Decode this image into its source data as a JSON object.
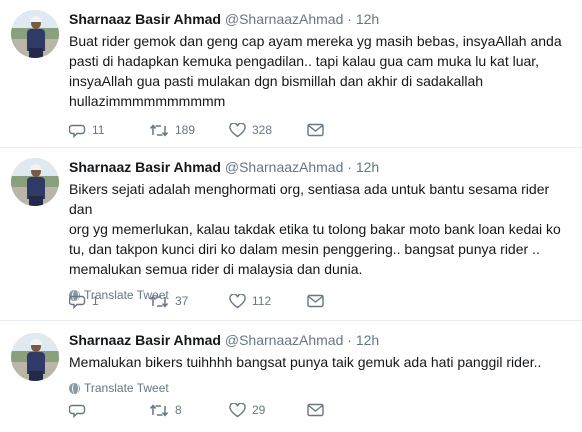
{
  "tweets": [
    {
      "name": "Sharnaaz Basir Ahmad",
      "handle": "@SharnaazAhmad",
      "separator": "·",
      "time": "12h",
      "lines": [
        "Buat rider gemok dan geng cap ayam mereka yg masih bebas, insyaAllah anda",
        "pasti di hadapkan kemuka pengadilan.. tapi kalau gua cam muka lu kat luar,",
        "insyaAllah gua pasti mulakan dgn bismillah dan akhir di sadakallah",
        "hullazimmmmmmmmmm"
      ],
      "replies": "11",
      "retweets": "189",
      "likes": "328"
    },
    {
      "name": "Sharnaaz Basir Ahmad",
      "handle": "@SharnaazAhmad",
      "separator": "·",
      "time": "12h",
      "lines": [
        "Bikers sejati adalah menghormati org, sentiasa ada untuk bantu sesama rider dan",
        "org yg memerlukan, kalau takdak etika tu tolong bakar moto bank loan kedai ko",
        "tu, dan takpon kunci diri ko dalam mesin penggering.. bangsat punya rider ..",
        "memalukan semua rider di malaysia dan dunia."
      ],
      "translate": "Translate Tweet",
      "replies": "1",
      "retweets": "37",
      "likes": "112"
    },
    {
      "name": "Sharnaaz Basir Ahmad",
      "handle": "@SharnaazAhmad",
      "separator": "·",
      "time": "12h",
      "lines": [
        "Memalukan bikers tuihhhh bangsat punya taik gemuk ada hati panggil rider.."
      ],
      "translate": "Translate Tweet",
      "replies": "",
      "retweets": "8",
      "likes": "29"
    }
  ],
  "icons": {
    "reply": "reply-icon",
    "retweet": "retweet-icon",
    "like": "heart-icon",
    "dm": "envelope-icon",
    "translate": "globe-icon"
  },
  "colors": {
    "icon": "#657786",
    "border": "#e6ecf0",
    "text": "#14171a"
  }
}
